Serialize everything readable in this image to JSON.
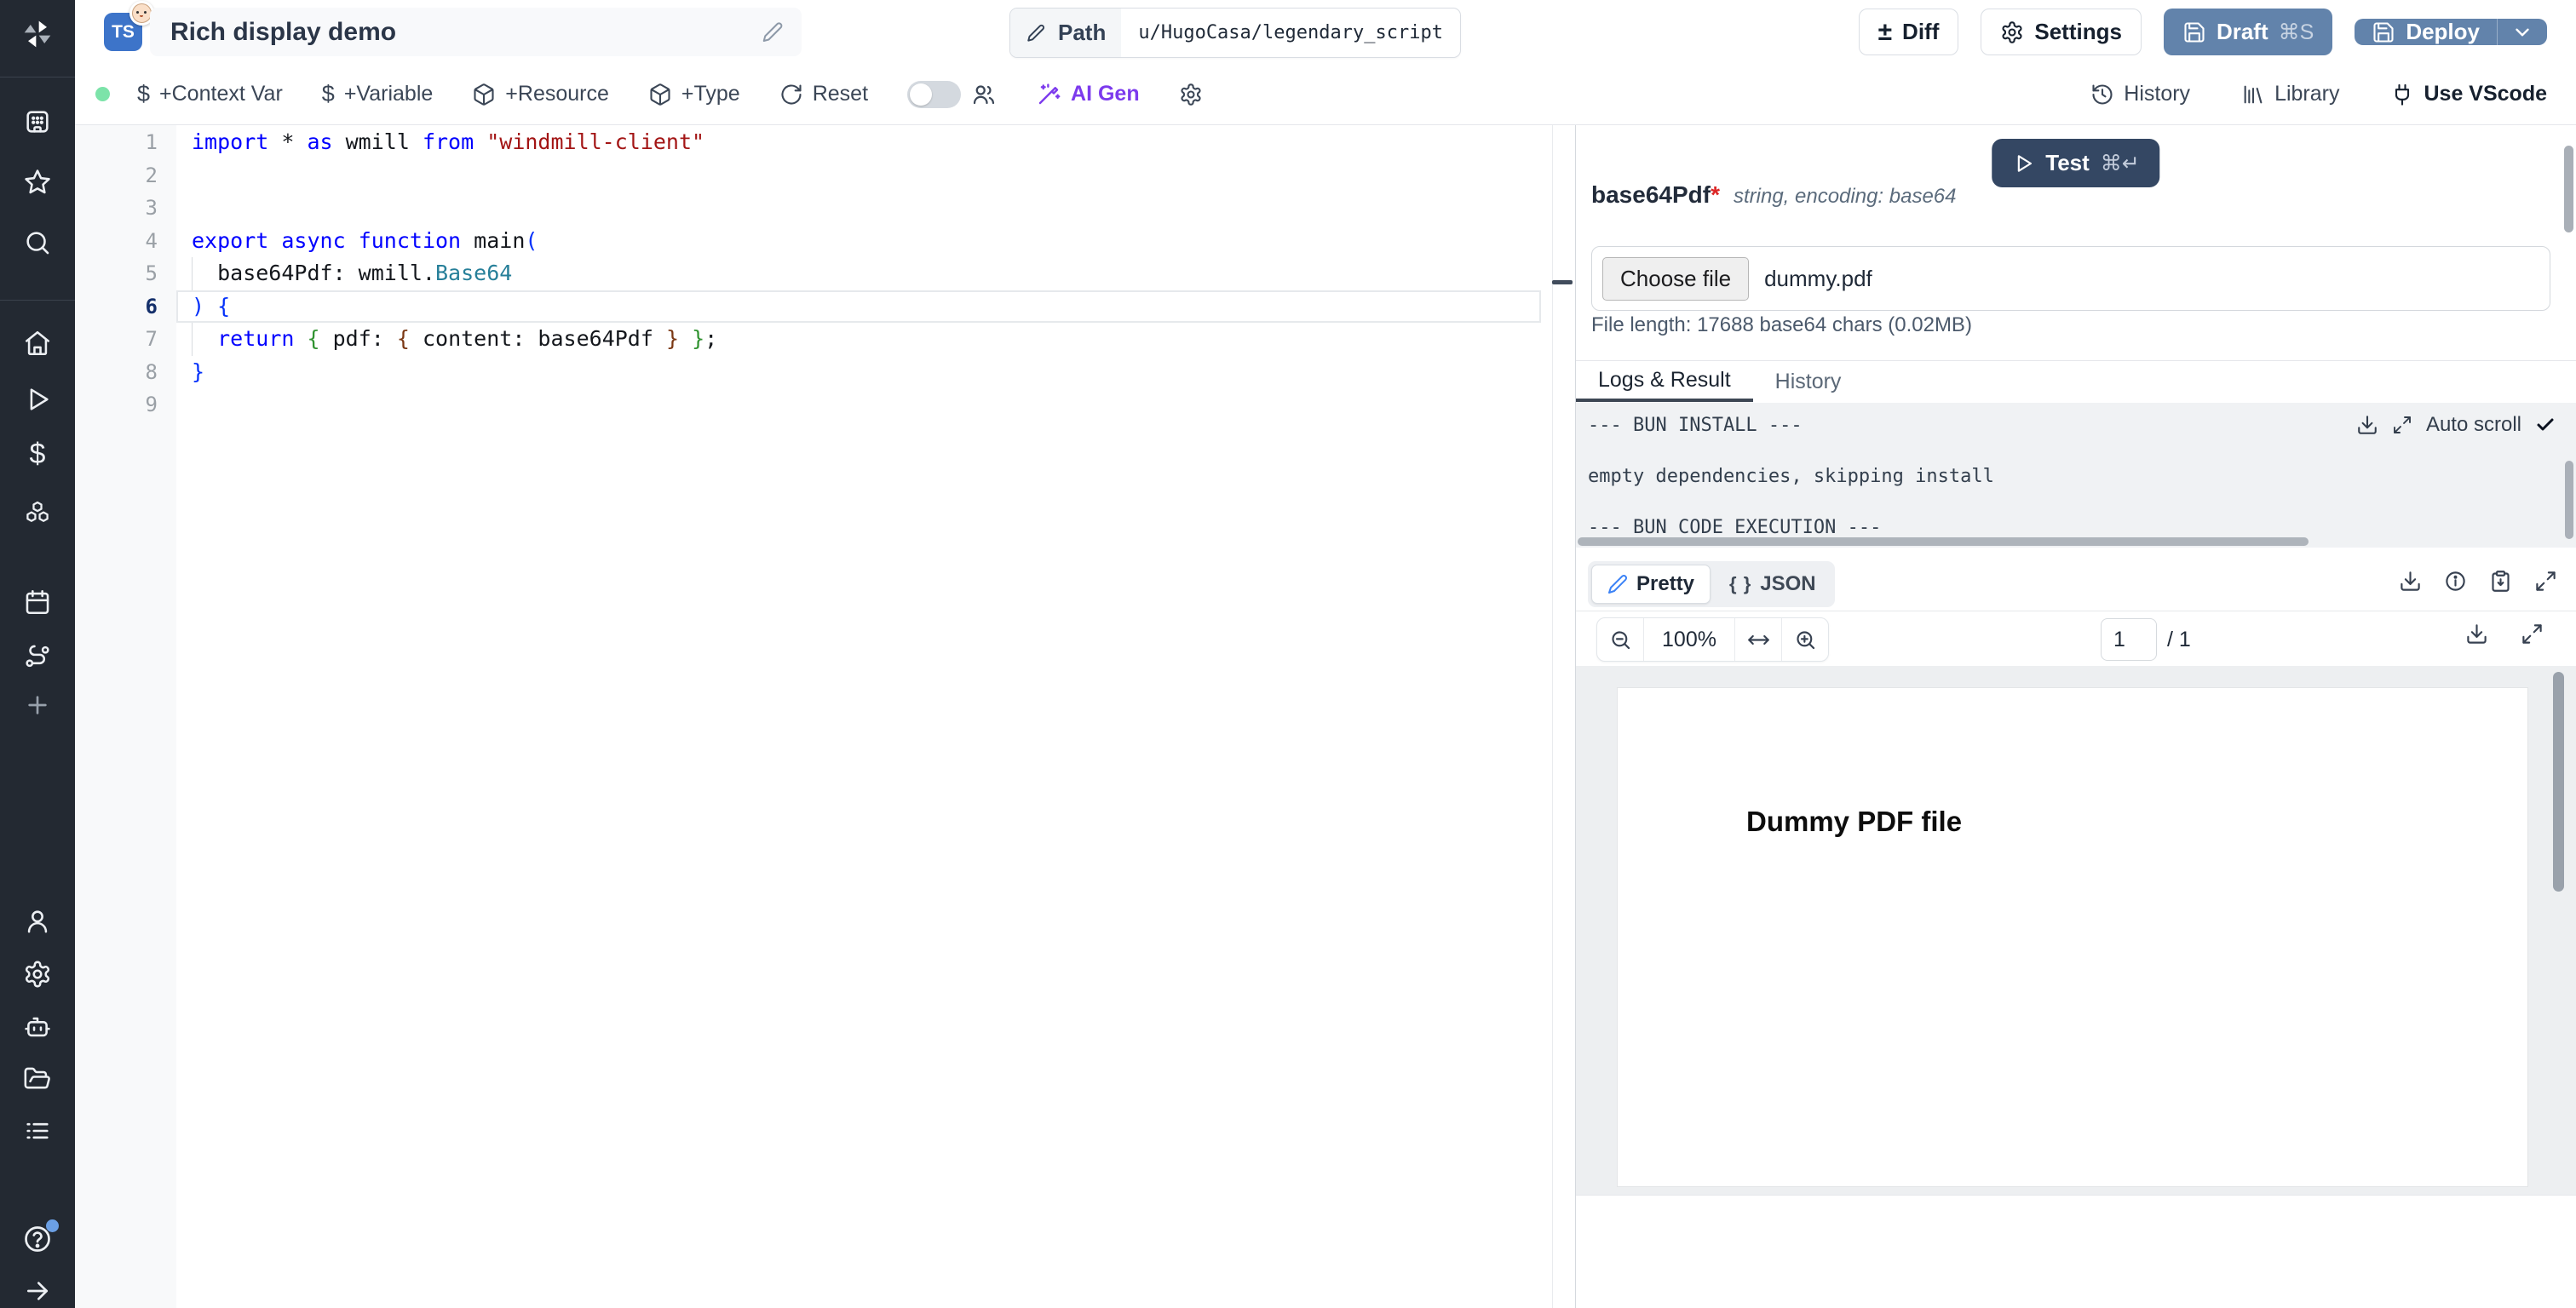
{
  "colors": {
    "sidebar-dark": "#232932",
    "ts-badge-blue": "#3d74c9",
    "deploy-blue": "#6283ab",
    "test-navy": "#344763",
    "ai-purple": "#7c3aed",
    "success-green": "#7ce3a9",
    "accent-blue": "#3b82f6",
    "asterisk-red": "#dc2626"
  },
  "sidebar": {
    "dollar_glyph": "$",
    "icons": [
      "windmill-logo",
      "workspace-grid",
      "favorites-star",
      "search",
      "home",
      "runs-play",
      "variables-dollar",
      "resources-cubes",
      "schedules-calendar",
      "routes",
      "add-plus",
      "user",
      "settings-gear",
      "workers-robot",
      "folders",
      "audit-logs-list",
      "help",
      "collapse-arrow"
    ]
  },
  "header": {
    "language_badge": "TS",
    "badge_emoji": "baby-face",
    "title": "Rich display demo",
    "path_label": "Path",
    "path_value": "u/HugoCasa/legendary_script",
    "diff_glyph": "±",
    "actions": {
      "diff": "Diff",
      "settings": "Settings",
      "draft": "Draft",
      "draft_shortcut": "⌘S",
      "deploy": "Deploy"
    }
  },
  "toolbar": {
    "dollar_glyph": "$",
    "left_items": [
      {
        "icon": "dollar",
        "label": "+Context Var"
      },
      {
        "icon": "dollar",
        "label": "+Variable"
      },
      {
        "icon": "package",
        "label": "+Resource"
      },
      {
        "icon": "package",
        "label": "+Type"
      },
      {
        "icon": "reset",
        "label": "Reset"
      }
    ],
    "ai_gen_label": "AI Gen",
    "right_items": {
      "history": "History",
      "library": "Library",
      "vscode": "Use VScode"
    }
  },
  "editor": {
    "lines": [
      {
        "num": "1",
        "tokens": [
          [
            "kw",
            "import"
          ],
          [
            "pl",
            " * "
          ],
          [
            "kw",
            "as"
          ],
          [
            "pl",
            " wmill "
          ],
          [
            "kw",
            "from"
          ],
          [
            "pl",
            " "
          ],
          [
            "str",
            "\"windmill-client\""
          ]
        ]
      },
      {
        "num": "2",
        "tokens": []
      },
      {
        "num": "3",
        "tokens": []
      },
      {
        "num": "4",
        "tokens": [
          [
            "kw",
            "export"
          ],
          [
            "pl",
            " "
          ],
          [
            "kw",
            "async"
          ],
          [
            "pl",
            " "
          ],
          [
            "kw",
            "function"
          ],
          [
            "pl",
            " main"
          ],
          [
            "b1",
            "("
          ]
        ]
      },
      {
        "num": "5",
        "tokens": [
          [
            "pl",
            "  base64Pdf: wmill."
          ],
          [
            "typ",
            "Base64"
          ]
        ]
      },
      {
        "num": "6",
        "active": true,
        "tokens": [
          [
            "b1",
            ") {"
          ]
        ]
      },
      {
        "num": "7",
        "tokens": [
          [
            "pl",
            "  "
          ],
          [
            "kw",
            "return"
          ],
          [
            "pl",
            " "
          ],
          [
            "b2",
            "{"
          ],
          [
            "pl",
            " pdf: "
          ],
          [
            "b3",
            "{"
          ],
          [
            "pl",
            " content: base64Pdf "
          ],
          [
            "b3",
            "}"
          ],
          [
            "pl",
            " "
          ],
          [
            "b2",
            "}"
          ],
          [
            "pl",
            ";"
          ]
        ]
      },
      {
        "num": "8",
        "tokens": [
          [
            "b1",
            "}"
          ]
        ]
      },
      {
        "num": "9",
        "tokens": []
      }
    ]
  },
  "run_panel": {
    "test_label": "Test",
    "test_shortcut": "⌘↵",
    "arg": {
      "name": "base64Pdf",
      "required_mark": "*",
      "type_hint": "string, encoding: base64"
    },
    "file_input": {
      "button_label": "Choose file",
      "file_name": "dummy.pdf"
    },
    "file_length_note": "File length: 17688 base64 chars (0.02MB)",
    "tabs": [
      {
        "label": "Logs & Result"
      },
      {
        "label": "History"
      }
    ],
    "autoscroll_label": "Auto scroll",
    "logs": "--- BUN INSTALL ---\n\nempty dependencies, skipping install\n\n--- BUN CODE EXECUTION ---",
    "result_view": {
      "pretty_label": "Pretty",
      "json_glyph": "{ }",
      "json_label": "JSON"
    },
    "pdf_viewer": {
      "zoom_level": "100%",
      "page_number": "1",
      "page_total": "/ 1",
      "content_text": "Dummy PDF file"
    }
  }
}
